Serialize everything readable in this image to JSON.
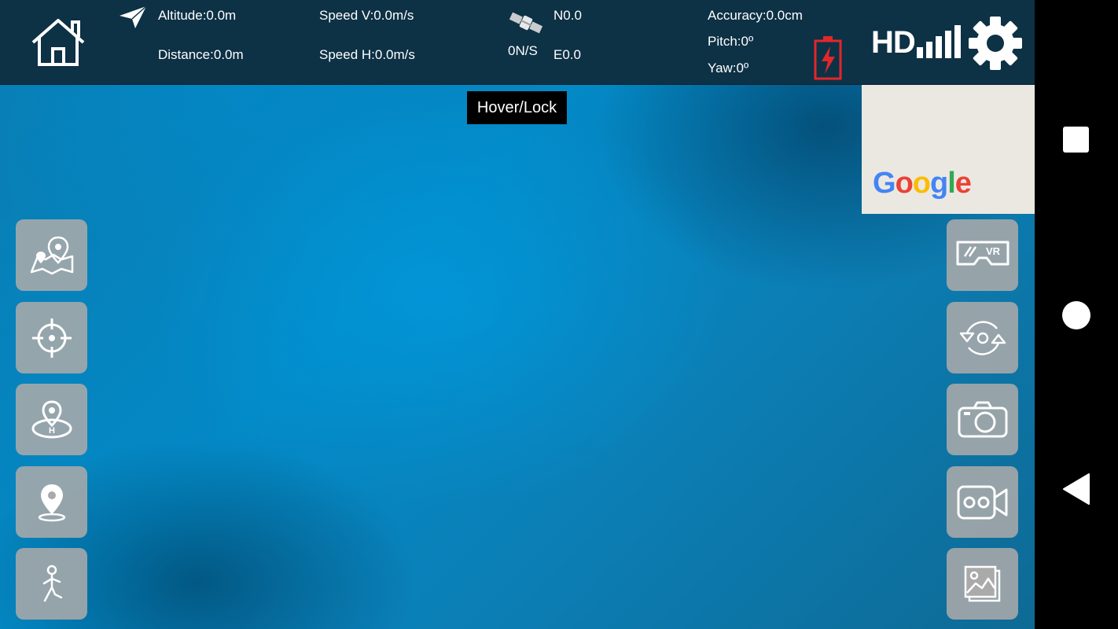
{
  "telemetry": {
    "altitude": "Altitude:0.0m",
    "distance": "Distance:0.0m",
    "speed_v": "Speed V:0.0m/s",
    "speed_h": "Speed H:0.0m/s",
    "satellites": "0N/S",
    "north": "N0.0",
    "east": "E0.0",
    "accuracy": "Accuracy:0.0cm",
    "pitch": "Pitch:0º",
    "yaw": "Yaw:0º",
    "signal_label": "HD"
  },
  "mode_label": "Hover/Lock",
  "map": {
    "brand": [
      "G",
      "o",
      "o",
      "g",
      "l",
      "e"
    ]
  },
  "icons": {
    "top": [
      "home-icon",
      "paper-plane-icon",
      "satellite-icon",
      "battery-charging-icon",
      "hd-signal-icon",
      "gear-icon"
    ],
    "left": [
      "map-pin-icon",
      "crosshair-icon",
      "helipad-icon",
      "location-pin-icon",
      "walking-person-icon"
    ],
    "right": [
      "vr-headset-icon",
      "rotate-icon",
      "camera-icon",
      "video-camera-icon",
      "gallery-icon"
    ],
    "nav": [
      "recents-square-icon",
      "home-circle-icon",
      "back-triangle-icon"
    ]
  },
  "colors": {
    "battery": "#e3262c",
    "google_blue": "#4285F4",
    "google_red": "#EA4335",
    "google_yellow": "#FBBC05",
    "google_green": "#34A853"
  }
}
